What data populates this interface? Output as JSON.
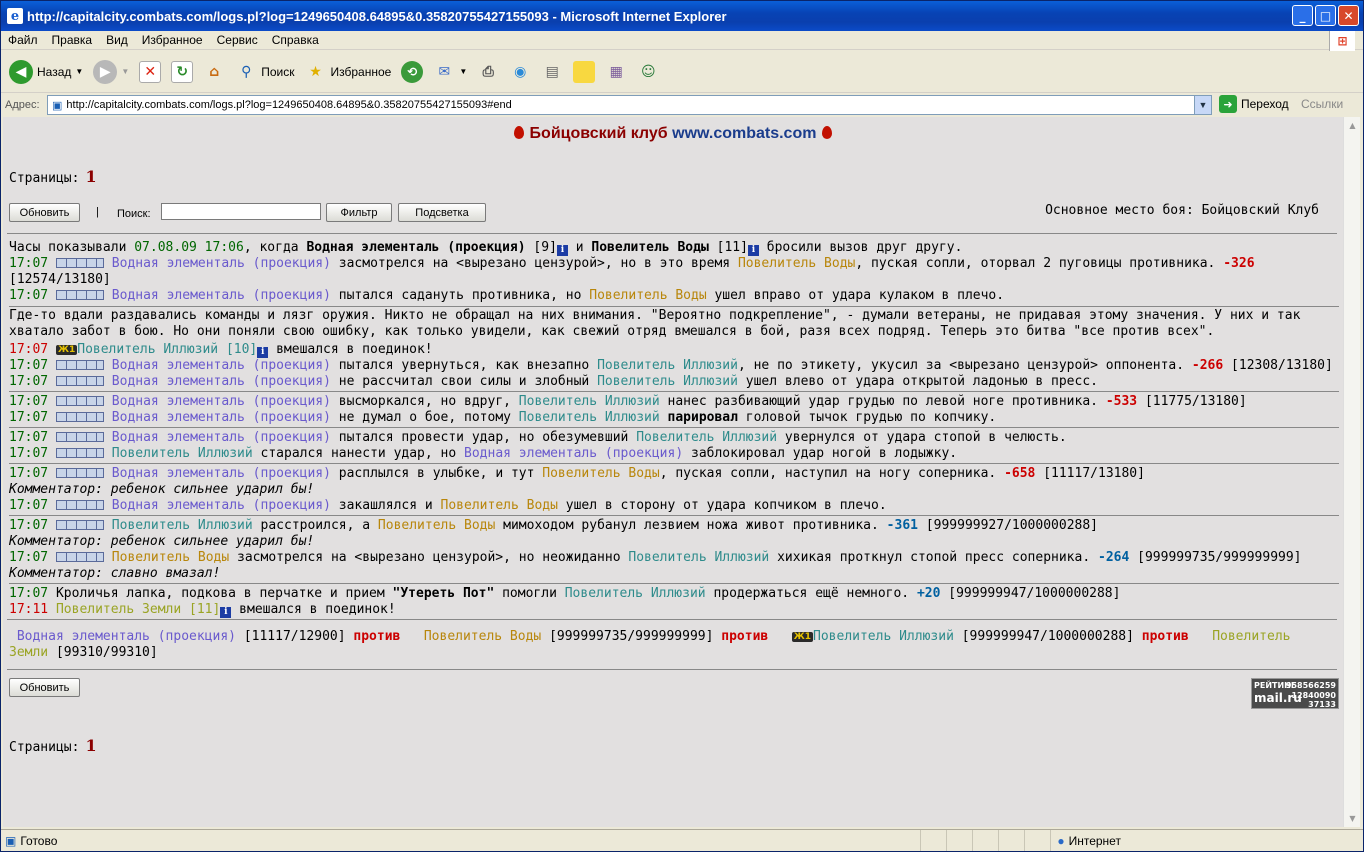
{
  "window": {
    "title": "http://capitalcity.combats.com/logs.pl?log=1249650408.64895&0.35820755427155093 - Microsoft Internet Explorer",
    "minimize": "_",
    "maximize": "□",
    "close": "✕"
  },
  "menu": [
    "Файл",
    "Правка",
    "Вид",
    "Избранное",
    "Сервис",
    "Справка"
  ],
  "toolbar": {
    "back": "Назад",
    "search": "Поиск",
    "favorites": "Избранное"
  },
  "address": {
    "label": "Адрес:",
    "url": "http://capitalcity.combats.com/logs.pl?log=1249650408.64895&0.35820755427155093#end",
    "go": "Переход",
    "links": "Ссылки"
  },
  "page": {
    "header_title": "Бойцовский клуб",
    "header_url": "www.combats.com",
    "pages_label": "Страницы:",
    "pages_value": "1",
    "refresh": "Обновить",
    "sep": "|",
    "search_label": "Поиск:",
    "filter": "Фильтр",
    "highlight": "Подсветка",
    "place": "Основное место боя: Бойцовский Клуб"
  },
  "log": {
    "intro": [
      "Часы показывали",
      "07.08.09 17:06",
      ", когда",
      "Водная элементаль (проекция)",
      "[9]",
      "и",
      "Повелитель Воды",
      "[11]",
      "бросили вызов друг другу."
    ],
    "l1": [
      "17:07",
      "Водная элементаль (проекция)",
      "засмотрелся на <вырезано цензурой>, но в это время",
      "Повелитель Воды",
      ", пуская сопли, оторвал 2 пуговицы противника.",
      "-326"
    ],
    "l1b": "[12574/13180]",
    "l2": [
      "17:07",
      "Водная элементаль (проекция)",
      "пытался садануть противника, но",
      "Повелитель Воды",
      "ушел вправо от удара кулаком в плечо."
    ],
    "para": "Где-то вдали раздавались команды и лязг оружия. Никто не обращал на них внимания. \"Вероятно подкрепление\", - думали ветераны, не придавая этому значения. У них и так хватало забот в бою. Но они поняли свою ошибку, как только увидели, как свежий отряд вмешался в бой, разя всех подряд. Теперь это битва \"все против всех\".",
    "l3": [
      "17:07",
      "Повелитель Иллюзий [10]",
      "вмешался в поединок!"
    ],
    "l4": [
      "17:07",
      "Водная элементаль (проекция)",
      "пытался увернуться, как внезапно",
      "Повелитель Иллюзий",
      ", не по этикету, укусил за <вырезано цензурой> оппонента.",
      "-266",
      "[12308/13180]"
    ],
    "l5": [
      "17:07",
      "Водная элементаль (проекция)",
      "не рассчитал свои силы и злобный",
      "Повелитель Иллюзий",
      "ушел влево от удара открытой ладонью в пресс."
    ],
    "l6": [
      "17:07",
      "Водная элементаль (проекция)",
      "высморкался, но вдруг,",
      "Повелитель Иллюзий",
      "нанес разбивающий удар грудью по левой ноге противника.",
      "-533",
      "[11775/13180]"
    ],
    "l7": [
      "17:07",
      "Водная элементаль (проекция)",
      "не думал о бое, потому",
      "Повелитель Иллюзий",
      "парировал",
      "головой тычок грудью по копчику."
    ],
    "l8": [
      "17:07",
      "Водная элементаль (проекция)",
      "пытался провести удар, но обезумевший",
      "Повелитель Иллюзий",
      "увернулся от удара стопой в челюсть."
    ],
    "l9": [
      "17:07",
      "Повелитель Иллюзий",
      "старался нанести удар, но",
      "Водная элементаль (проекция)",
      "заблокировал удар ногой в лодыжку."
    ],
    "l10": [
      "17:07",
      "Водная элементаль (проекция)",
      "расплылся в улыбке, и тут",
      "Повелитель Воды",
      ", пуская сопли, наступил на ногу соперника.",
      "-658",
      "[11117/13180]"
    ],
    "c1": "Комментатор: ребенок сильнее ударил бы!",
    "l11": [
      "17:07",
      "Водная элементаль (проекция)",
      "закашлялся и",
      "Повелитель Воды",
      "ушел в сторону от удара копчиком в плечо."
    ],
    "l12": [
      "17:07",
      "Повелитель Иллюзий",
      "расстроился, а",
      "Повелитель Воды",
      "мимоходом рубанул лезвием ножа живот противника.",
      "-361",
      "[999999927/1000000288]"
    ],
    "c2": "Комментатор: ребенок сильнее ударил бы!",
    "l13": [
      "17:07",
      "Повелитель Воды",
      "засмотрелся на <вырезано цензурой>, но неожиданно",
      "Повелитель Иллюзий",
      "хихикая проткнул стопой пресс соперника.",
      "-264",
      "[999999735/999999999]"
    ],
    "c3": "Комментатор: славно вмазал!",
    "l14": [
      "17:07",
      "Кроличья лапка, подкова в перчатке и прием",
      "\"Утереть Пот\"",
      "помогли",
      "Повелитель Иллюзий",
      "продержаться ещё немного.",
      "+20",
      "[999999947/1000000288]"
    ],
    "l15": [
      "17:11",
      "Повелитель Земли [11]",
      "вмешался в поединок!"
    ]
  },
  "summary": {
    "w1": "Водная элементаль (проекция)",
    "w1hp": "[11117/12900]",
    "vs": "против",
    "w2": "Повелитель Воды",
    "w2hp": "[999999735/999999999]",
    "w3": "Повелитель Иллюзий",
    "w3hp": "[999999947/1000000288]",
    "w4": "Повелитель Земли",
    "w4hp": "[99310/99310]"
  },
  "rating": {
    "label": "РЕЙТИНГ",
    "n1": "958566259",
    "brand": "mail.ru",
    "n2": "12840090",
    "n3": "37133"
  },
  "badge": "Ж1",
  "info_icon": "i",
  "status": {
    "ready": "Готово",
    "zone": "Интернет"
  },
  "colors": {
    "p1": "#6a5acd",
    "p2": "#b8860b",
    "p3": "#2e8b8b",
    "p4": "#9aa424",
    "damage": "#cc0000",
    "heal": "#0060a0"
  }
}
